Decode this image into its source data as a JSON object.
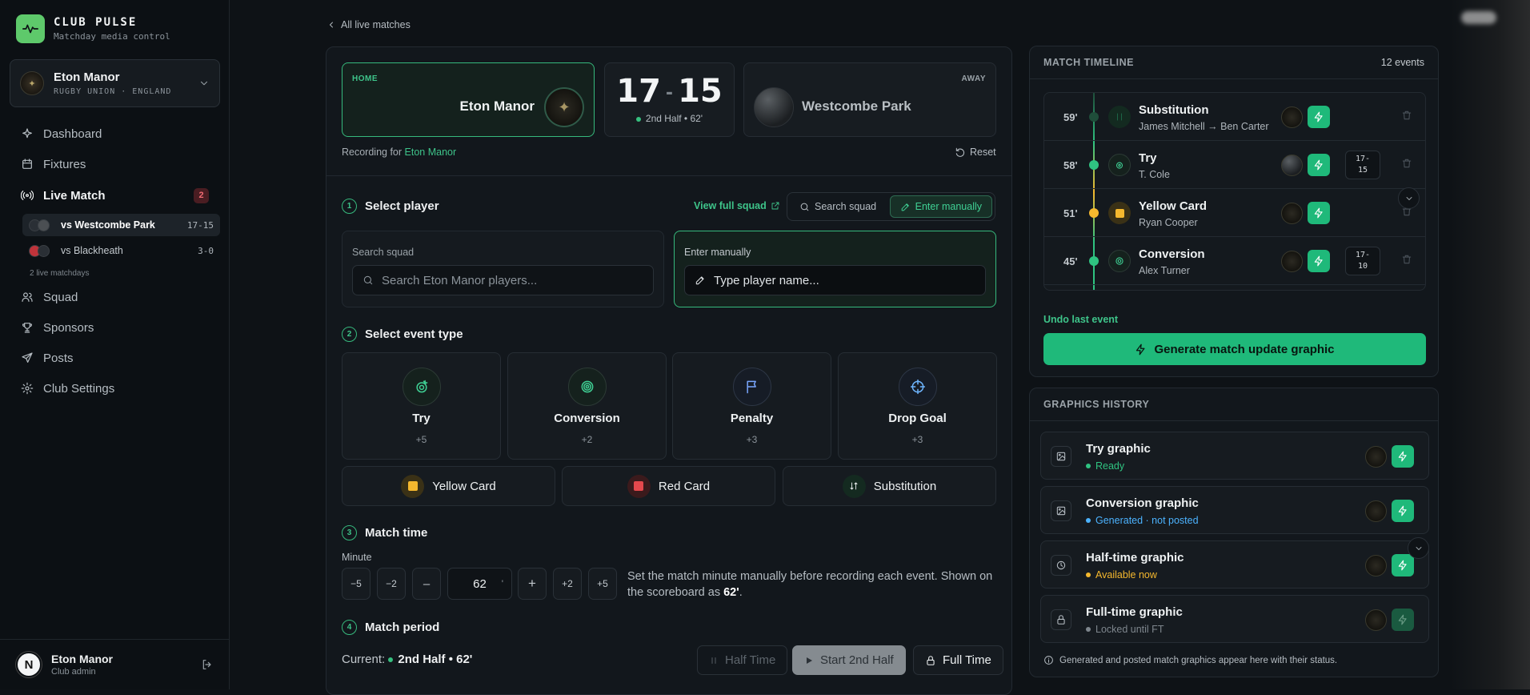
{
  "brand": {
    "name": "CLUB PULSE",
    "tagline": "Matchday media control"
  },
  "club": {
    "name": "Eton Manor",
    "meta": "RUGBY UNION · ENGLAND"
  },
  "nav": {
    "dashboard": "Dashboard",
    "fixtures": "Fixtures",
    "live": "Live Match",
    "live_count": "2",
    "squad": "Squad",
    "sponsors": "Sponsors",
    "posts": "Posts",
    "settings": "Club Settings"
  },
  "live_matches": [
    {
      "label": "vs Westcombe Park",
      "score": "17-15"
    },
    {
      "label": "vs Blackheath",
      "score": "3-0"
    }
  ],
  "live_note": "2 live matchdays",
  "user": {
    "name": "Eton Manor",
    "role": "Club admin",
    "initial": "N"
  },
  "back_link": "All live matches",
  "match": {
    "home_label": "HOME",
    "home": "Eton Manor",
    "away_label": "AWAY",
    "away": "Westcombe Park",
    "home_score": "17",
    "away_score": "15",
    "period": "2nd Half • 62'",
    "recording_prefix": "Recording for",
    "recording_team": "Eton Manor",
    "reset": "Reset"
  },
  "step1": {
    "num": "1",
    "title": "Select player",
    "view_squad": "View full squad",
    "search_tab": "Search squad",
    "manual_tab": "Enter manually",
    "search_label": "Search squad",
    "search_placeholder": "Search Eton Manor players...",
    "manual_label": "Enter manually",
    "manual_placeholder": "Type player name..."
  },
  "step2": {
    "num": "2",
    "title": "Select event type",
    "events": [
      {
        "name": "Try",
        "points": "+5"
      },
      {
        "name": "Conversion",
        "points": "+2"
      },
      {
        "name": "Penalty",
        "points": "+3"
      },
      {
        "name": "Drop Goal",
        "points": "+3"
      }
    ],
    "cards": [
      {
        "name": "Yellow Card",
        "color": "#f5b82e"
      },
      {
        "name": "Red Card",
        "color": "#e5484d"
      },
      {
        "name": "Substitution"
      }
    ]
  },
  "step3": {
    "num": "3",
    "title": "Match time",
    "minute_label": "Minute",
    "buttons": [
      "−5",
      "−2",
      "–",
      "+",
      "+2",
      "+5"
    ],
    "minute_value": "62",
    "minute_suffix": "'",
    "help_text": "Set the match minute manually before recording each event. Shown on the scoreboard as ",
    "help_value": "62'",
    "help_end": "."
  },
  "step4": {
    "num": "4",
    "title": "Match period",
    "current_label": "Current:",
    "current_value": "2nd Half • 62'",
    "half_time": "Half Time",
    "start_2nd": "Start 2nd Half",
    "full_time": "Full Time"
  },
  "timeline": {
    "title": "MATCH TIMELINE",
    "count": "12 events",
    "events": [
      {
        "minute": "59'",
        "name": "Substitution",
        "detail": "James Mitchell → Ben Carter",
        "score": "",
        "color": "#1f6b4b"
      },
      {
        "minute": "58'",
        "name": "Try",
        "detail": "T. Cole",
        "score": "17-\n15",
        "color": "#2fc381"
      },
      {
        "minute": "51'",
        "name": "Yellow Card",
        "detail": "Ryan Cooper",
        "score": "",
        "color": "#f5b82e"
      },
      {
        "minute": "45'",
        "name": "Conversion",
        "detail": "Alex Turner",
        "score": "17-\n10",
        "color": "#2fc381"
      }
    ],
    "undo": "Undo last event",
    "generate": "Generate match update graphic"
  },
  "history": {
    "title": "GRAPHICS HISTORY",
    "items": [
      {
        "name": "Try graphic",
        "status": "Ready",
        "color": "#2fc381"
      },
      {
        "name": "Conversion graphic",
        "status": "Generated · not posted",
        "color": "#4cb3ff"
      },
      {
        "name": "Half-time graphic",
        "status": "Available now",
        "color": "#f5b82e"
      },
      {
        "name": "Full-time graphic",
        "status": "Locked until FT",
        "color": "#7e868d"
      }
    ],
    "footer": "Generated and posted match graphics appear here with their status."
  }
}
